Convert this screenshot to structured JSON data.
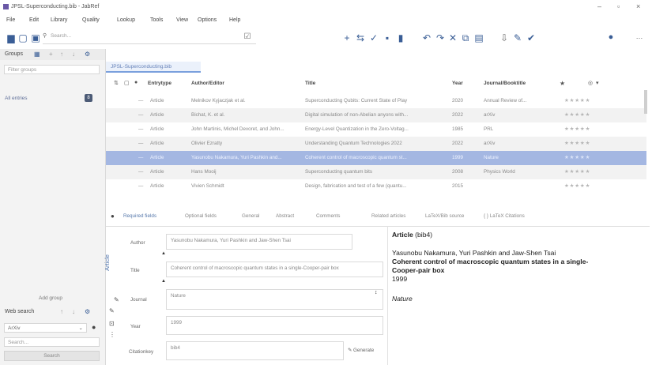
{
  "window": {
    "title": "JPSL-Superconducting.bib - JabRef",
    "minimize": "–",
    "maximize": "▫",
    "close": "×"
  },
  "menu": [
    "File",
    "Edit",
    "Library",
    "Quality",
    "Lookup",
    "Tools",
    "View",
    "Options",
    "Help"
  ],
  "toolbar": {
    "search_placeholder": "Search..."
  },
  "groups_panel": {
    "title": "Groups",
    "filter_placeholder": "Filter groups",
    "all_entries_label": "All entries",
    "all_entries_count": "8",
    "add_group_label": "Add group"
  },
  "web_search": {
    "title": "Web search",
    "source_value": "ArXiv",
    "query_placeholder": "Search...",
    "search_button": "Search"
  },
  "library_tab": "JPSL-Superconducting.bib",
  "table": {
    "headers": [
      "Entrytype",
      "Author/Editor",
      "Title",
      "Year",
      "Journal/Booktitle"
    ],
    "rows": [
      {
        "type": "Article",
        "author": "Melnikov Kyjaczjak et al.",
        "title": "Superconducting Qubits: Current State of Play",
        "year": "2020",
        "journal": "Annual Review of...",
        "rank": "★★★★★"
      },
      {
        "type": "Article",
        "author": "Bichat, K. et al.",
        "title": "Digital simulation of non-Abelian anyons with...",
        "year": "2022",
        "journal": "arXiv",
        "rank": "★★★★★"
      },
      {
        "type": "Article",
        "author": "John Martinis, Michel Devoret, and John...",
        "title": "Energy-Level Quantization in the Zero-Voltag...",
        "year": "1985",
        "journal": "PRL",
        "rank": "★★★★★"
      },
      {
        "type": "Article",
        "author": "Olivier Ezratty",
        "title": "Understanding Quantum Technologies 2022",
        "year": "2022",
        "journal": "arXiv",
        "rank": "★★★★★"
      },
      {
        "type": "Article",
        "author": "Yasunobu Nakamura, Yuri Pashkin and...",
        "title": "Coherent control of macroscopic quantum st...",
        "year": "1999",
        "journal": "Nature",
        "rank": "★★★★★"
      },
      {
        "type": "Article",
        "author": "Hans Mooij",
        "title": "Superconducting quantum bits",
        "year": "2008",
        "journal": "Physics World",
        "rank": "★★★★★"
      },
      {
        "type": "Article",
        "author": "Vivien Schmidt",
        "title": "Design, fabrication and test of a few (quantu...",
        "year": "2015",
        "journal": "",
        "rank": "★★★★★"
      }
    ]
  },
  "editor": {
    "tabs": [
      "Required fields",
      "Optional fields",
      "General",
      "Abstract",
      "Comments",
      "Related articles",
      "LaTeX/Bib source",
      "{ } LaTeX Citations"
    ],
    "side_label": "Article",
    "fields": [
      {
        "label": "Author",
        "value": "Yasunobu Nakamura, Yuri Pashkin and Jaw-Shen Tsai"
      },
      {
        "label": "Title",
        "value": "Coherent control of macroscopic quantum states in a single-Cooper-pair box"
      },
      {
        "label": "Journal",
        "value": "Nature"
      },
      {
        "label": "Year",
        "value": "1999"
      },
      {
        "label": "Citationkey",
        "value": "bib4"
      }
    ],
    "generate_button": "Generate"
  },
  "preview": {
    "type_line": "Article",
    "key": "(bib4)",
    "authors": "Yasunobu Nakamura, Yuri Pashkin and Jaw-Shen Tsai",
    "title_line1": "Coherent control of macroscopic quantum states in a single-",
    "title_line2": "Cooper-pair box",
    "year": "1999",
    "journal": "Nature"
  }
}
